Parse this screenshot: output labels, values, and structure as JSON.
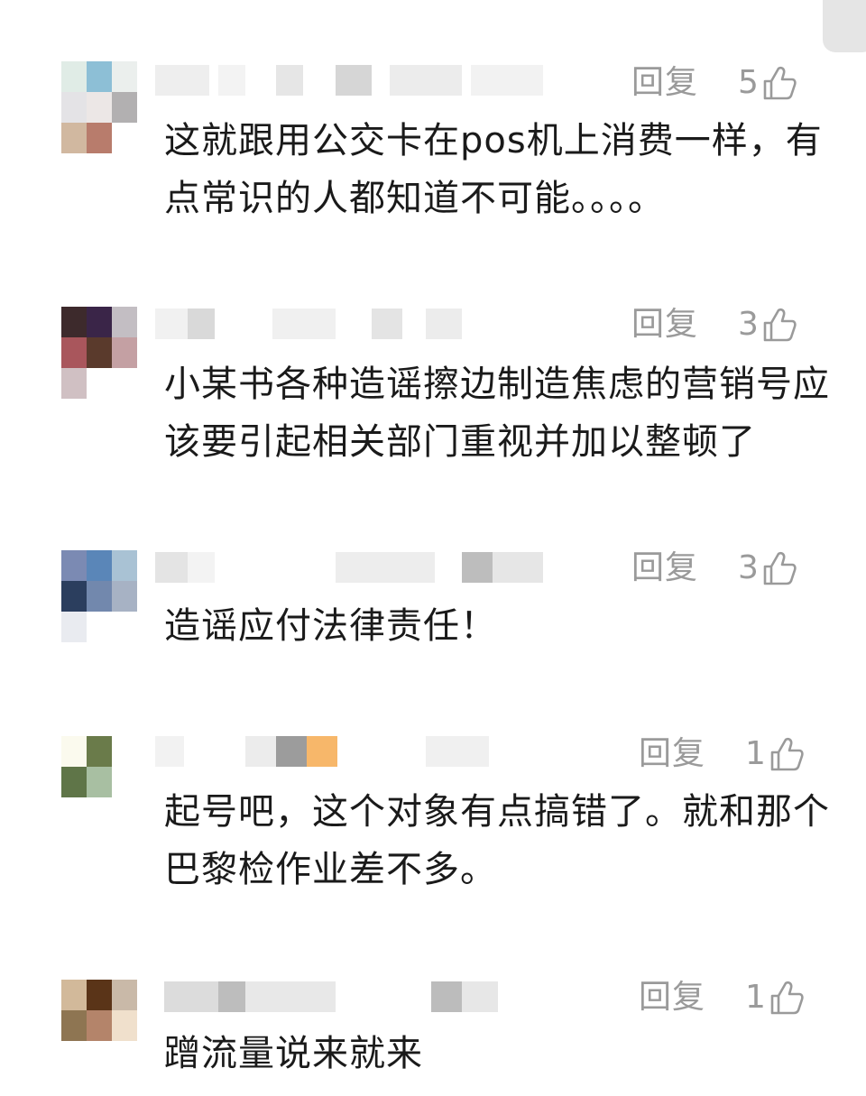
{
  "ui": {
    "reply_label": "回复"
  },
  "comments": [
    {
      "text": "这就跟用公交卡在pos机上消费一样，有点常识的人都知道不可能。。。。",
      "likes": "5",
      "avatar_colors": [
        "#e0ece6",
        "#8dbfd6",
        "#ebefed",
        "#e4e3e6",
        "#ece7e6",
        "#b2b0b1",
        "#d1b8a0",
        "#b87c6c",
        "#ffffff"
      ]
    },
    {
      "text": "小某书各种造谣擦边制造焦虑的营销号应该要引起相关部门重视并加以整顿了",
      "likes": "3",
      "avatar_colors": [
        "#3d2a2c",
        "#3a2548",
        "#c3bec3",
        "#a9565c",
        "#5a3a2c",
        "#c4a0a3",
        "#d0c0c3",
        "#ffffff",
        "#ffffff"
      ]
    },
    {
      "text": "造谣应付法律责任！",
      "likes": "3",
      "avatar_colors": [
        "#7b8ab3",
        "#5a86b8",
        "#a9c2d4",
        "#2b3e5e",
        "#7288ad",
        "#a7b2c4",
        "#e9ebf0",
        "#ffffff",
        "#ffffff"
      ]
    },
    {
      "text": "起号吧，这个对象有点搞错了。就和那个巴黎检作业差不多。",
      "likes": "1",
      "avatar_colors": [
        "#fbfaee",
        "#6a7b4a",
        "#ffffff",
        "#5f7548",
        "#a8bfa2",
        "#ffffff",
        "#ffffff",
        "#ffffff",
        "#ffffff"
      ]
    },
    {
      "text": "蹭流量说来就来",
      "likes": "1",
      "avatar_colors": [
        "#d2b99a",
        "#5a3418",
        "#c9b9a8",
        "#8e7552",
        "#b4846a",
        "#f0e0cc",
        "#ffffff",
        "#ffffff",
        "#ffffff"
      ]
    }
  ]
}
